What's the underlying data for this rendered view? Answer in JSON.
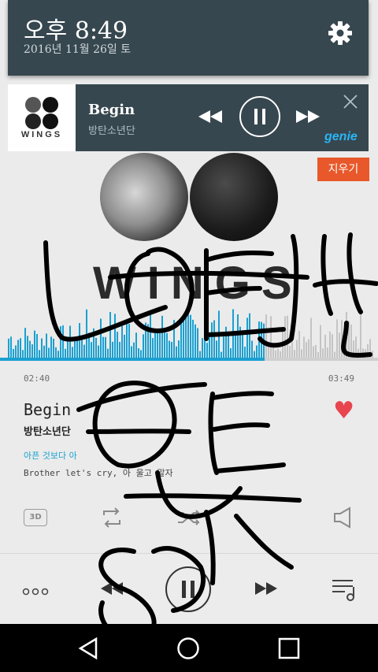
{
  "status": {
    "time": "오후 8:49",
    "date": "2016년 11월 26일 토"
  },
  "notification": {
    "album_logo_text": "WINGS",
    "title": "Begin",
    "artist": "방탄소년단",
    "brand": "genie"
  },
  "overlay": {
    "clear_button": "지우기"
  },
  "player": {
    "album_word": "WINGS",
    "elapsed": "02:40",
    "total": "03:49",
    "progress": 0.7,
    "title": "Begin",
    "artist": "방탄소년단",
    "lyric_current": "아픈 것보다 아",
    "lyric_next": "Brother let's cry, 아 울고 말자",
    "btn_3d": "3D",
    "liked": true
  },
  "icons": [
    "settings-icon",
    "notif-prev-icon",
    "notif-pause-icon",
    "notif-next-icon",
    "close-icon",
    "repeat-icon",
    "shuffle-icon",
    "volume-icon",
    "more-icon",
    "prev-icon",
    "pause-icon",
    "next-icon",
    "playlist-icon",
    "back-icon",
    "home-icon",
    "recent-apps-icon"
  ],
  "colors": {
    "shade": "#37474f",
    "accent": "#1aa0d0",
    "heart": "#e8454e",
    "clear": "#e8582a"
  }
}
